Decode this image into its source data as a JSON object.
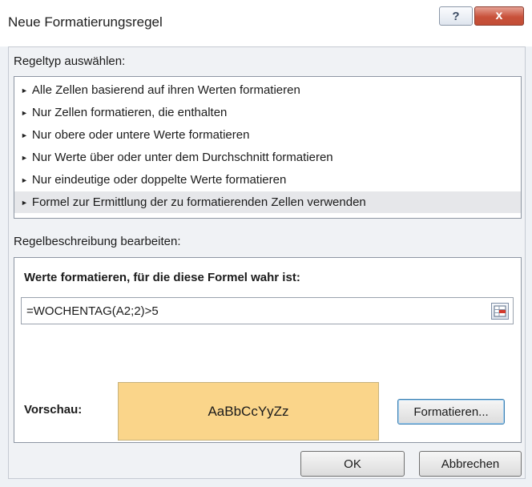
{
  "window": {
    "title": "Neue Formatierungsregel",
    "help_glyph": "?",
    "close_glyph": "x"
  },
  "rule_type": {
    "label": "Regeltyp auswählen:",
    "items": [
      {
        "label": "Alle Zellen basierend auf ihren Werten formatieren",
        "selected": false
      },
      {
        "label": "Nur Zellen formatieren, die enthalten",
        "selected": false
      },
      {
        "label": "Nur obere oder untere Werte formatieren",
        "selected": false
      },
      {
        "label": "Nur Werte über oder unter dem Durchschnitt formatieren",
        "selected": false
      },
      {
        "label": "Nur eindeutige oder doppelte Werte formatieren",
        "selected": false
      },
      {
        "label": "Formel zur Ermittlung der zu formatierenden Zellen verwenden",
        "selected": true
      }
    ],
    "bullet": "►"
  },
  "rule_description": {
    "label": "Regelbeschreibung bearbeiten:",
    "formula_heading": "Werte formatieren, für die diese Formel wahr ist:",
    "formula_value": "=WOCHENTAG(A2;2)>5",
    "preview_label": "Vorschau:",
    "preview_sample": "AaBbCcYyZz",
    "preview_fill_color": "#fad58a",
    "format_button": "Formatieren..."
  },
  "footer": {
    "ok_button": "OK",
    "cancel_button": "Abbrechen"
  },
  "colors": {
    "close_button": "#c8513a",
    "selected_row": "#e6e7ea"
  }
}
